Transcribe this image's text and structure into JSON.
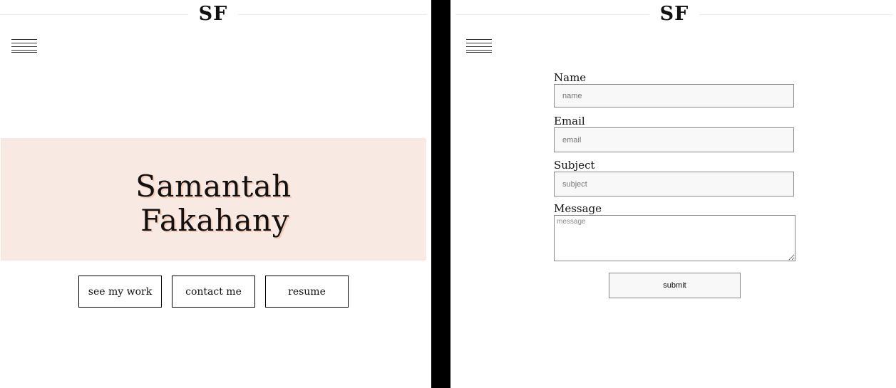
{
  "home": {
    "logo": "SF",
    "hero": {
      "name_line1": "Samantah",
      "name_line2": "Fakahany"
    },
    "buttons": [
      "see my work",
      "contact me",
      "resume"
    ]
  },
  "contact": {
    "logo": "SF",
    "form": {
      "name": {
        "label": "Name",
        "placeholder": "name",
        "value": ""
      },
      "email": {
        "label": "Email",
        "placeholder": "email",
        "value": ""
      },
      "subject": {
        "label": "Subject",
        "placeholder": "subject",
        "value": ""
      },
      "message": {
        "label": "Message",
        "placeholder": "message",
        "value": ""
      },
      "submit_label": "submit"
    }
  },
  "colors": {
    "hero_background": "#f9e9e3",
    "divider": "#000000",
    "input_background": "#f8f8f8"
  }
}
